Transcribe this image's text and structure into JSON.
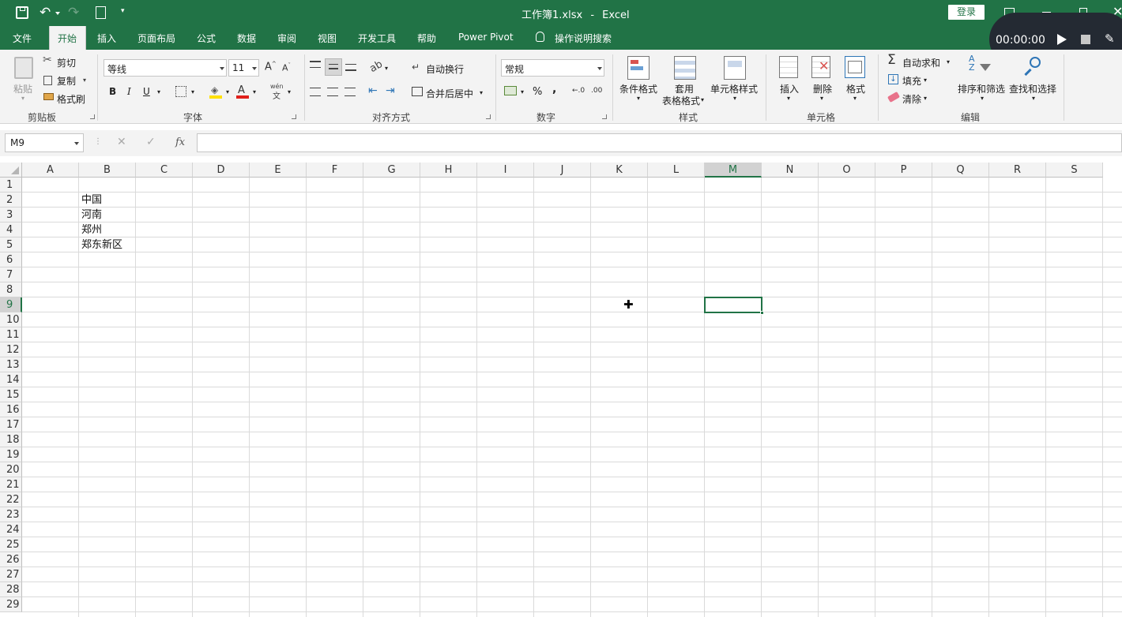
{
  "titlebar": {
    "file_name": "工作簿1.xlsx",
    "separator": "-",
    "app_name": "Excel",
    "login_label": "登录"
  },
  "recorder": {
    "time": "00:00:00"
  },
  "menu": {
    "items": [
      "文件",
      "开始",
      "插入",
      "页面布局",
      "公式",
      "数据",
      "审阅",
      "视图",
      "开发工具",
      "帮助",
      "Power Pivot"
    ],
    "search_label": "操作说明搜索"
  },
  "ribbon": {
    "clipboard": {
      "paste": "粘贴",
      "cut": "剪切",
      "copy": "复制",
      "format_painter": "格式刷",
      "label": "剪贴板"
    },
    "font": {
      "name": "等线",
      "size": "11",
      "bold": "B",
      "italic": "I",
      "underline": "U",
      "label": "字体",
      "wen": "wén",
      "wen_char": "文"
    },
    "alignment": {
      "wrap": "自动换行",
      "merge": "合并后居中",
      "label": "对齐方式"
    },
    "number": {
      "format": "常规",
      "percent": "%",
      "comma": ",",
      "label": "数字"
    },
    "styles": {
      "conditional": "条件格式",
      "table_l1": "套用",
      "table_l2": "表格格式",
      "cell_styles": "单元格样式",
      "label": "样式"
    },
    "cells": {
      "insert": "插入",
      "delete": "删除",
      "format": "格式",
      "label": "单元格"
    },
    "editing": {
      "autosum": "自动求和",
      "fill": "填充",
      "clear": "清除",
      "sort": "排序和筛选",
      "find": "查找和选择",
      "label": "编辑"
    }
  },
  "formula_bar": {
    "name_box": "M9",
    "fx": "fx",
    "value": ""
  },
  "sheet": {
    "columns": [
      "A",
      "B",
      "C",
      "D",
      "E",
      "F",
      "G",
      "H",
      "I",
      "J",
      "K",
      "L",
      "M",
      "N",
      "O",
      "P",
      "Q",
      "R",
      "S"
    ],
    "rows": [
      "1",
      "2",
      "3",
      "4",
      "5",
      "6",
      "7",
      "8",
      "9",
      "10",
      "11",
      "12",
      "13",
      "14",
      "15",
      "16",
      "17",
      "18",
      "19",
      "20",
      "21",
      "22",
      "23",
      "24",
      "25",
      "26",
      "27",
      "28",
      "29"
    ],
    "cells": {
      "B2": "中国",
      "B3": "河南",
      "B4": "郑州",
      "B5": "郑东新区"
    },
    "selected": "M9"
  },
  "colors": {
    "excel_green": "#217346",
    "selection_green": "#217346",
    "ribbon_bg": "#f3f3f3"
  }
}
